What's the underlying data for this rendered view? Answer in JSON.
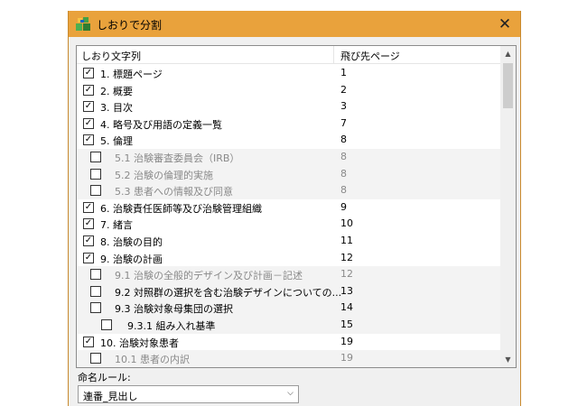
{
  "window": {
    "title": "しおりで分割",
    "close_glyph": "✕"
  },
  "list": {
    "columns": [
      "しおり文字列",
      "飛び先ページ"
    ],
    "rows": [
      {
        "label": "1. 標題ページ",
        "page": "1",
        "checked": true,
        "level": 0,
        "dim": false
      },
      {
        "label": "2. 概要",
        "page": "2",
        "checked": true,
        "level": 0,
        "dim": false
      },
      {
        "label": "3. 目次",
        "page": "3",
        "checked": true,
        "level": 0,
        "dim": false
      },
      {
        "label": "4. 略号及び用語の定義一覧",
        "page": "7",
        "checked": true,
        "level": 0,
        "dim": false
      },
      {
        "label": "5. 倫理",
        "page": "8",
        "checked": true,
        "level": 0,
        "dim": false
      },
      {
        "label": "5.1 治験審査委員会（IRB）",
        "page": "8",
        "checked": false,
        "level": 1,
        "dim": true
      },
      {
        "label": "5.2 治験の倫理的実施",
        "page": "8",
        "checked": false,
        "level": 1,
        "dim": true
      },
      {
        "label": "5.3 患者への情報及び同意",
        "page": "8",
        "checked": false,
        "level": 1,
        "dim": true
      },
      {
        "label": "6. 治験責任医師等及び治験管理組織",
        "page": "9",
        "checked": true,
        "level": 0,
        "dim": false
      },
      {
        "label": "7. 緒言",
        "page": "10",
        "checked": true,
        "level": 0,
        "dim": false
      },
      {
        "label": "8. 治験の目的",
        "page": "11",
        "checked": true,
        "level": 0,
        "dim": false
      },
      {
        "label": "9. 治験の計画",
        "page": "12",
        "checked": true,
        "level": 0,
        "dim": false
      },
      {
        "label": "9.1 治験の全般的デザイン及び計画－記述",
        "page": "12",
        "checked": false,
        "level": 1,
        "dim": true
      },
      {
        "label": "9.2 対照群の選択を含む治験デザインについての...",
        "page": "13",
        "checked": false,
        "level": 1,
        "dim": false
      },
      {
        "label": "9.3 治験対象母集団の選択",
        "page": "14",
        "checked": false,
        "level": 1,
        "dim": false
      },
      {
        "label": "9.3.1 組み入れ基準",
        "page": "15",
        "checked": false,
        "level": 2,
        "dim": false
      },
      {
        "label": "10. 治験対象患者",
        "page": "19",
        "checked": true,
        "level": 0,
        "dim": false
      },
      {
        "label": "10.1 患者の内訳",
        "page": "19",
        "checked": false,
        "level": 1,
        "dim": true
      }
    ]
  },
  "naming": {
    "label": "命名ルール:",
    "selected": "連番_見出し"
  },
  "icons": {
    "app": "split-bookmark-icon",
    "scroll_up": "▲",
    "scroll_down": "▼",
    "dropdown": "⌵"
  },
  "colors": {
    "titlebar": "#e9a23c",
    "sub_row_bg": "#f3f3f3",
    "dim_text": "#8a8a8a"
  }
}
